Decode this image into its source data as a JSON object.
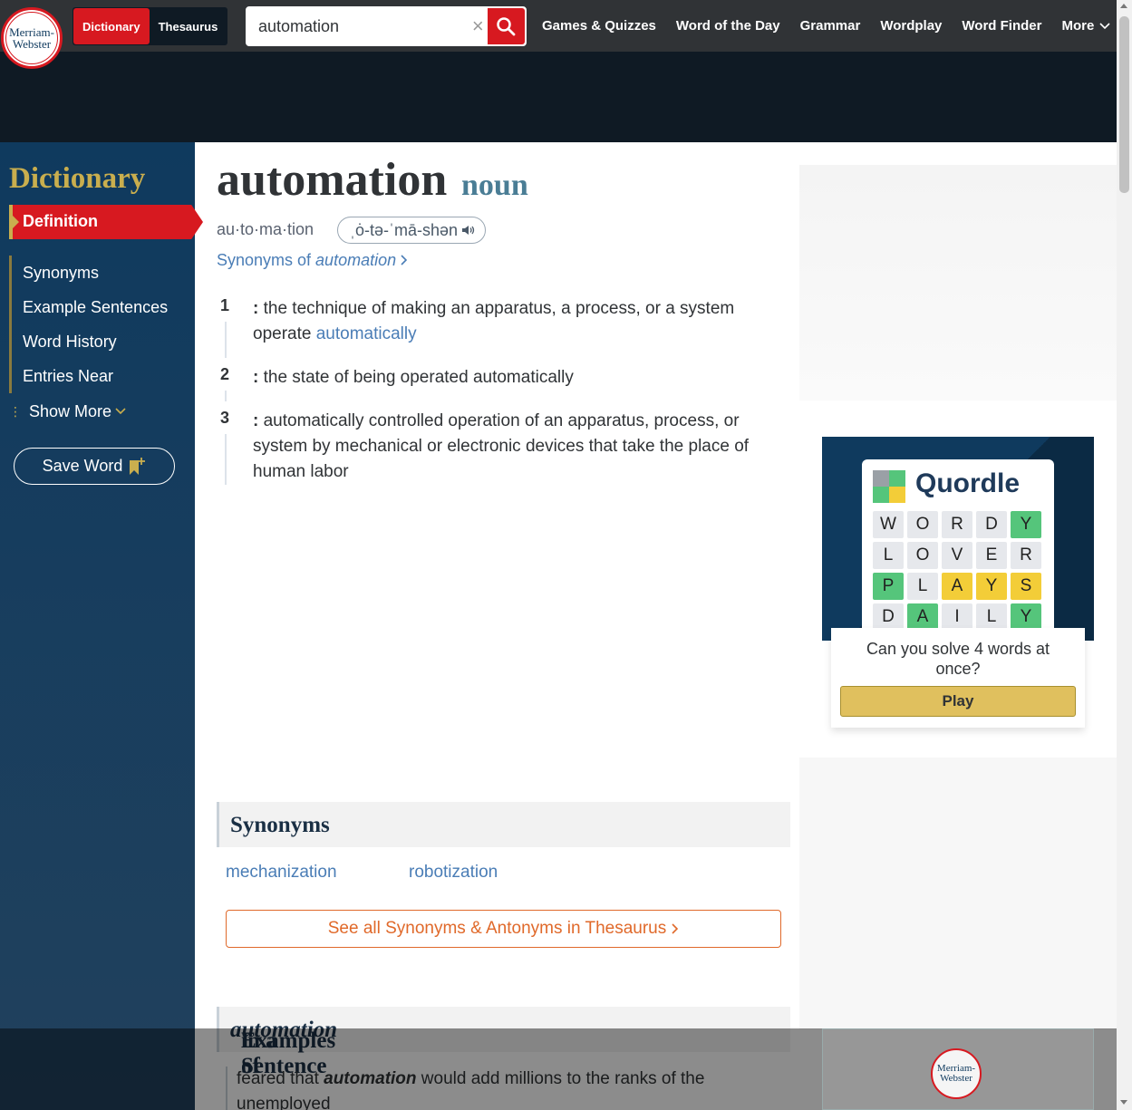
{
  "logo": {
    "line1": "Merriam-",
    "line2": "Webster"
  },
  "header": {
    "tabs": [
      {
        "label": "Dictionary",
        "active": true
      },
      {
        "label": "Thesaurus",
        "active": false
      }
    ],
    "search": {
      "value": "automation",
      "clear_icon": "close-icon",
      "search_icon": "search-icon"
    },
    "nav": [
      "Games & Quizzes",
      "Word of the Day",
      "Grammar",
      "Wordplay",
      "Word Finder",
      "More"
    ]
  },
  "sidebar": {
    "title": "Dictionary",
    "active_item": "Definition",
    "items": [
      "Synonyms",
      "Example Sentences",
      "Word History",
      "Entries Near"
    ],
    "show_more": "Show More",
    "save_word": "Save Word"
  },
  "entry": {
    "headword": "automation",
    "part_of_speech": "noun",
    "syllables": "au·​to·​ma·​tion",
    "pronunciation": "ˌȯ-tə-ˈmā-shən",
    "synonyms_link_prefix": "Synonyms of ",
    "synonyms_link_word": "automation",
    "senses": [
      {
        "num": "1",
        "text": "the technique of making an apparatus, a process, or a system operate ",
        "link": "automatically"
      },
      {
        "num": "2",
        "text": "the state of being operated automatically",
        "link": ""
      },
      {
        "num": "3",
        "text": "automatically controlled operation of an apparatus, process, or system by mechanical or electronic devices that take the place of human labor",
        "link": ""
      }
    ]
  },
  "synonyms": {
    "heading": "Synonyms",
    "words": [
      "mechanization",
      "robotization"
    ],
    "thesaurus_button": "See all Synonyms & Antonyms in Thesaurus"
  },
  "examples": {
    "heading_prefix": "Examples of ",
    "heading_word": "automation",
    "heading_suffix": " in a Sentence",
    "sentence_prefix": "feared that ",
    "sentence_word": "automation",
    "sentence_suffix": " would add millions to the ranks of the unemployed"
  },
  "quordle": {
    "title": "Quordle",
    "rows": [
      [
        {
          "l": "W",
          "c": ""
        },
        {
          "l": "O",
          "c": ""
        },
        {
          "l": "R",
          "c": ""
        },
        {
          "l": "D",
          "c": ""
        },
        {
          "l": "Y",
          "c": "g"
        }
      ],
      [
        {
          "l": "L",
          "c": ""
        },
        {
          "l": "O",
          "c": ""
        },
        {
          "l": "V",
          "c": ""
        },
        {
          "l": "E",
          "c": ""
        },
        {
          "l": "R",
          "c": ""
        }
      ],
      [
        {
          "l": "P",
          "c": "g"
        },
        {
          "l": "L",
          "c": ""
        },
        {
          "l": "A",
          "c": "y"
        },
        {
          "l": "Y",
          "c": "y"
        },
        {
          "l": "S",
          "c": "y"
        }
      ],
      [
        {
          "l": "D",
          "c": ""
        },
        {
          "l": "A",
          "c": "g"
        },
        {
          "l": "I",
          "c": ""
        },
        {
          "l": "L",
          "c": ""
        },
        {
          "l": "Y",
          "c": "g"
        }
      ]
    ],
    "caption": "Can you solve 4 words at once?",
    "button": "Play"
  },
  "colors": {
    "brand_red": "#d71920",
    "gold": "#c9ae4e",
    "navy": "#0f3a5e",
    "link": "#4a7db6",
    "orange": "#e0692a"
  }
}
